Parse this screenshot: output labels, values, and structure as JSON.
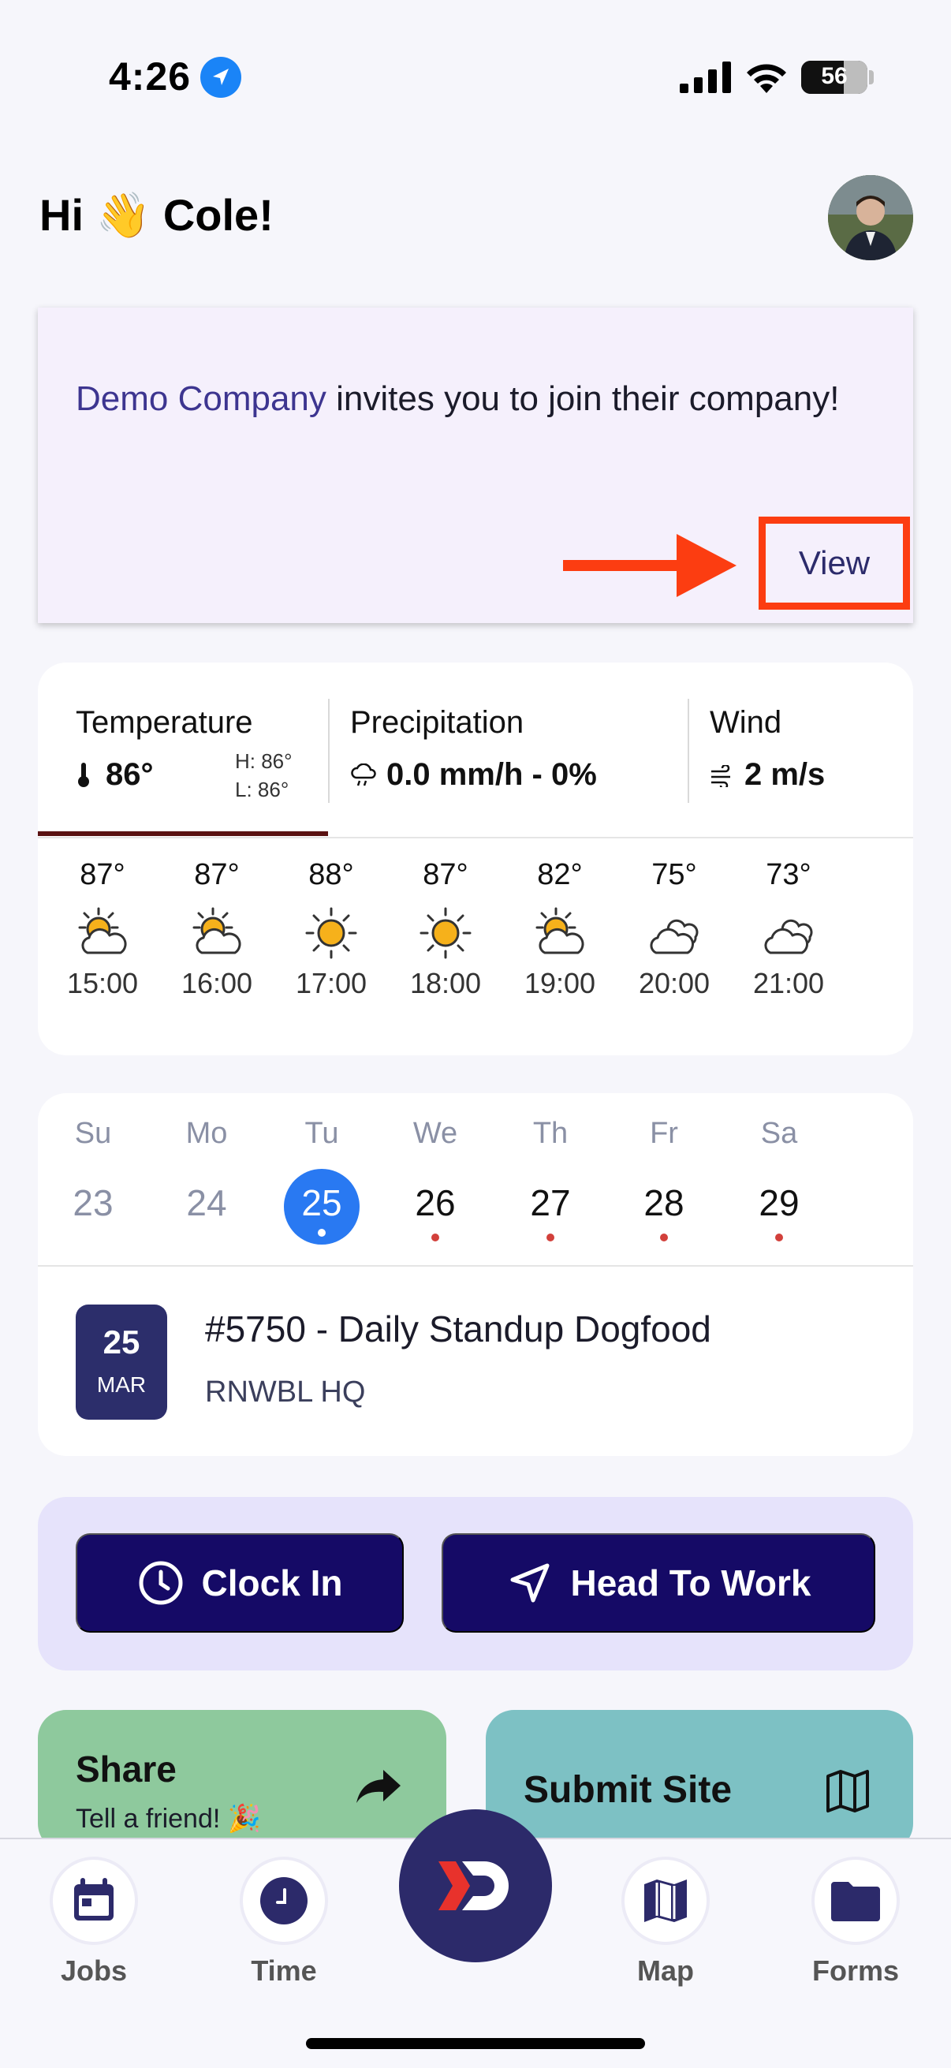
{
  "status_bar": {
    "time": "4:26",
    "battery": "56"
  },
  "greeting": {
    "text": "Hi 👋 Cole!"
  },
  "invite": {
    "company": "Demo Company",
    "message": " invites you to join their company!",
    "view_label": "View",
    "annotation_color": "#fc3d11"
  },
  "weather": {
    "temperature": {
      "label": "Temperature",
      "value": "86°",
      "high": "H: 86°",
      "low": "L: 86°"
    },
    "precipitation": {
      "label": "Precipitation",
      "value": "0.0 mm/h - 0%"
    },
    "wind": {
      "label": "Wind",
      "value": "2 m/s"
    },
    "hourly": [
      {
        "temp": "87°",
        "hour": "15:00",
        "icon": "partly-sunny-icon"
      },
      {
        "temp": "87°",
        "hour": "16:00",
        "icon": "partly-sunny-icon"
      },
      {
        "temp": "88°",
        "hour": "17:00",
        "icon": "sunny-icon"
      },
      {
        "temp": "87°",
        "hour": "18:00",
        "icon": "sunny-icon"
      },
      {
        "temp": "82°",
        "hour": "19:00",
        "icon": "partly-sunny-icon"
      },
      {
        "temp": "75°",
        "hour": "20:00",
        "icon": "cloudy-icon"
      },
      {
        "temp": "73°",
        "hour": "21:00",
        "icon": "cloudy-icon"
      }
    ]
  },
  "calendar": {
    "days": [
      "Su",
      "Mo",
      "Tu",
      "We",
      "Th",
      "Fr",
      "Sa"
    ],
    "dates": [
      "23",
      "24",
      "25",
      "26",
      "27",
      "28",
      "29"
    ],
    "selected": "25",
    "job": {
      "badge_day": "25",
      "badge_month": "MAR",
      "title": "#5750 - Daily Standup Dogfood",
      "location": "RNWBL HQ"
    }
  },
  "actions": {
    "clock_in": "Clock In",
    "head_to_work": "Head To Work"
  },
  "cards": {
    "share": {
      "title": "Share",
      "subtitle": "Tell a friend! 🎉"
    },
    "submit_site": {
      "title": "Submit Site"
    }
  },
  "tabbar": {
    "jobs": "Jobs",
    "time": "Time",
    "map": "Map",
    "forms": "Forms"
  },
  "colors": {
    "primary": "#150a66",
    "accent_blue": "#2979f2",
    "share_green": "#8ec99d",
    "site_teal": "#7dc1c4"
  }
}
